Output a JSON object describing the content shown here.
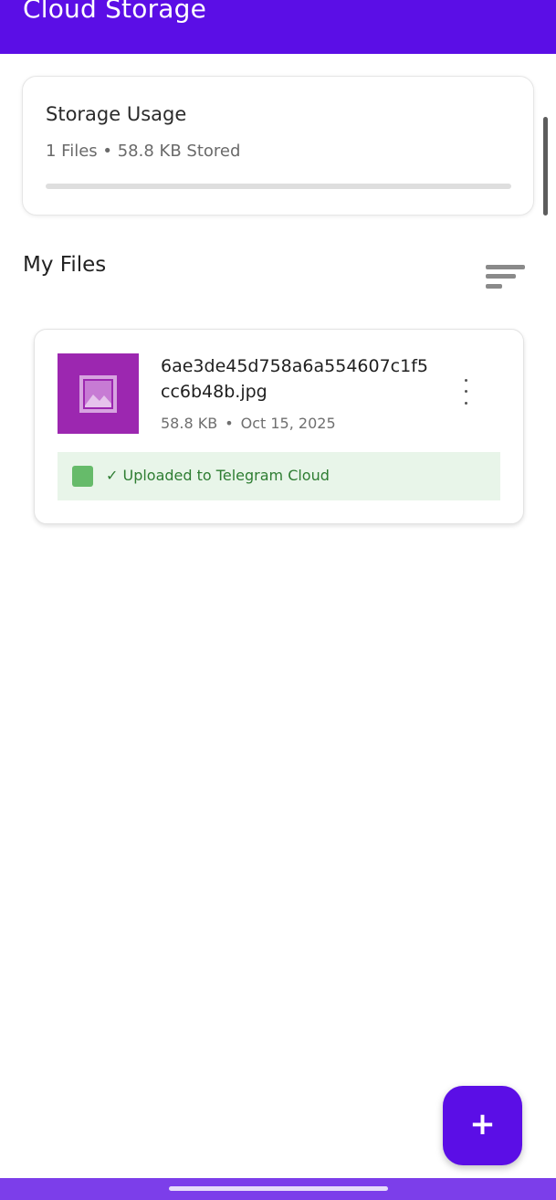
{
  "app_bar": {
    "title": "Cloud Storage"
  },
  "storage_usage": {
    "title": "Storage Usage",
    "summary": "1 Files • 58.8 KB Stored",
    "progress_fraction": 0.0
  },
  "files_section": {
    "title": "My Files",
    "sort_icon": "sort-icon"
  },
  "files": [
    {
      "name": "6ae3de45d758a6a554607c1f5cc6b48b.jpg",
      "size": "58.8 KB",
      "date": "Oct 15, 2025",
      "thumbnail_icon": "image-icon",
      "thumbnail_color": "#9c27b0",
      "status": "✓ Uploaded to Telegram Cloud",
      "status_color": "#2e7d32",
      "menu_icon": "more-vert-icon"
    }
  ],
  "fab": {
    "label": "+",
    "icon": "add-icon"
  },
  "colors": {
    "primary": "#5b0ee6",
    "nav_bar": "#7c3eea",
    "status_background": "#e8f5e9",
    "status_icon": "#66bb6a"
  }
}
